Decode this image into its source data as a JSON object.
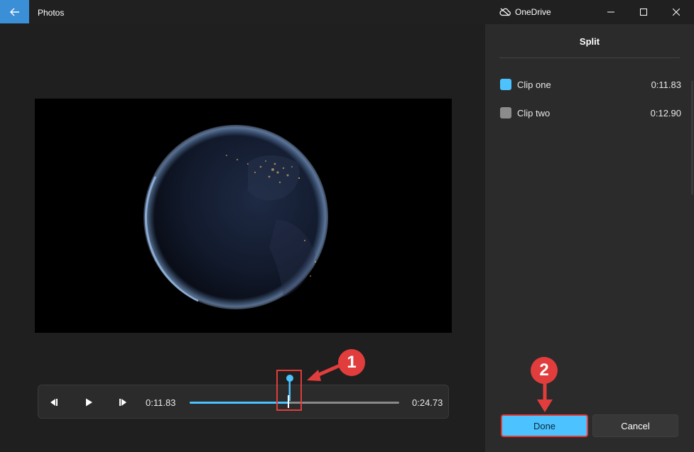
{
  "titlebar": {
    "app_title": "Photos",
    "onedrive_label": "OneDrive"
  },
  "player": {
    "current_time": "0:11.83",
    "total_time": "0:24.73",
    "progress_fraction": 0.478
  },
  "panel": {
    "title": "Split",
    "clips": [
      {
        "label": "Clip one",
        "duration": "0:11.83",
        "color": "#4cc2ff"
      },
      {
        "label": "Clip two",
        "duration": "0:12.90",
        "color": "#8c8c8c"
      }
    ],
    "done_label": "Done",
    "cancel_label": "Cancel"
  },
  "annotations": {
    "badge_1": "1",
    "badge_2": "2",
    "color": "#e23d3d"
  },
  "colors": {
    "accent": "#4cc2ff",
    "back_button": "#3a8fd6",
    "background": "#202020",
    "panel": "#2b2b2b"
  }
}
